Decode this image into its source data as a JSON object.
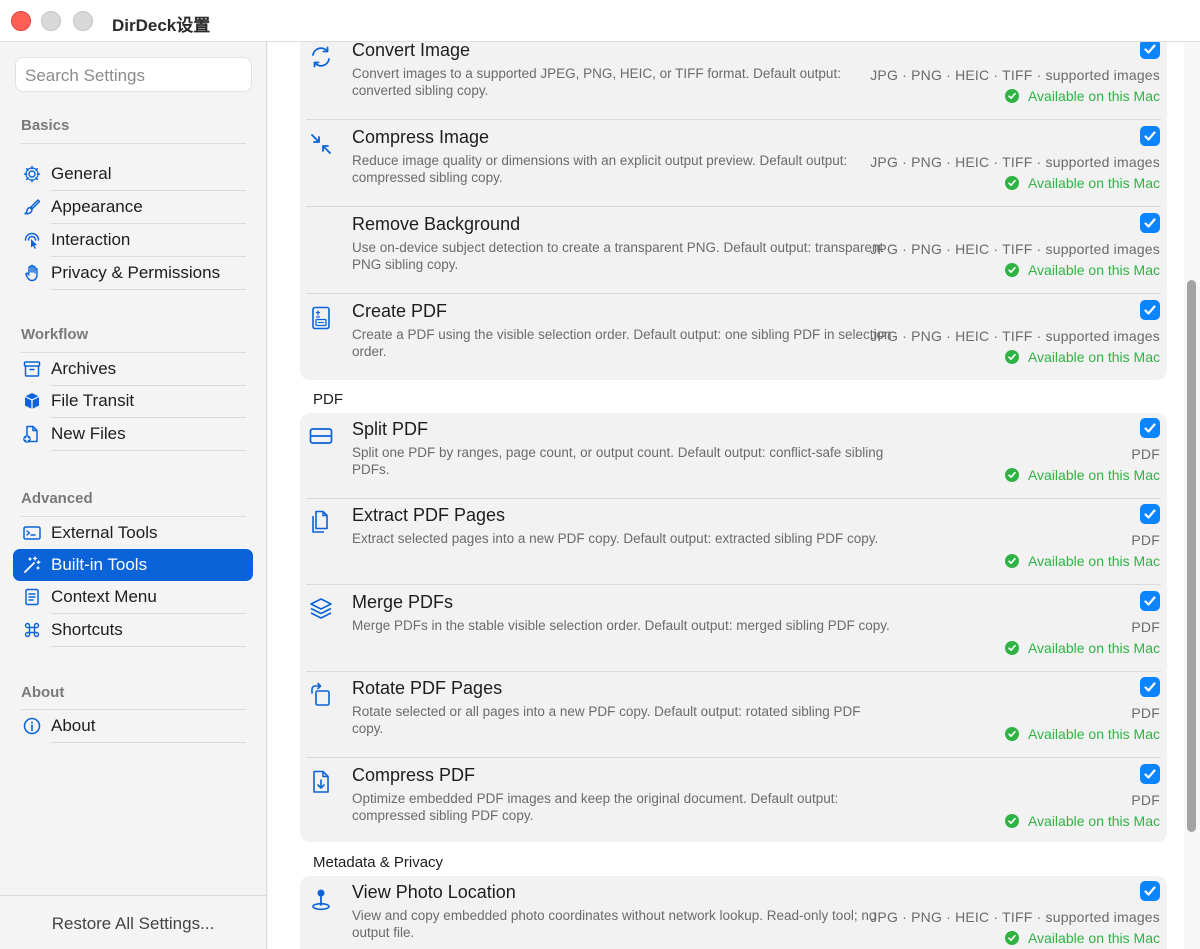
{
  "window": {
    "title": "DirDeck设置"
  },
  "sidebar": {
    "search_placeholder": "Search Settings",
    "sections": {
      "basics": "Basics",
      "workflow": "Workflow",
      "advanced": "Advanced",
      "about": "About"
    },
    "items": {
      "general": "General",
      "appearance": "Appearance",
      "interaction": "Interaction",
      "privacy": "Privacy & Permissions",
      "archives": "Archives",
      "file_transit": "File Transit",
      "new_files": "New Files",
      "external_tools": "External Tools",
      "builtin_tools": "Built-in Tools",
      "context_menu": "Context Menu",
      "shortcuts": "Shortcuts",
      "about": "About"
    },
    "selected": "Built-in Tools",
    "restore_label": "Restore All Settings..."
  },
  "content": {
    "image_formats": "JPG · PNG · HEIC · TIFF · supported images",
    "pdf_formats": "PDF",
    "available_label": "Available on this Mac",
    "groups": {
      "pdf": "PDF",
      "metadata": "Metadata & Privacy"
    },
    "tools": {
      "convert_image": {
        "title": "Convert Image",
        "desc": "Convert images to a supported JPEG, PNG, HEIC, or TIFF format. Default output: converted sibling copy.",
        "enabled": true
      },
      "compress_image": {
        "title": "Compress Image",
        "desc": "Reduce image quality or dimensions with an explicit output preview. Default output: compressed sibling copy.",
        "enabled": true
      },
      "remove_background": {
        "title": "Remove Background",
        "desc": "Use on-device subject detection to create a transparent PNG. Default output: transparent PNG sibling copy.",
        "enabled": true
      },
      "create_pdf": {
        "title": "Create PDF",
        "desc": "Create a PDF using the visible selection order. Default output: one sibling PDF in selection order.",
        "enabled": true
      },
      "split_pdf": {
        "title": "Split PDF",
        "desc": "Split one PDF by ranges, page count, or output count. Default output: conflict-safe sibling PDFs.",
        "enabled": true
      },
      "extract_pdf_pages": {
        "title": "Extract PDF Pages",
        "desc": "Extract selected pages into a new PDF copy. Default output: extracted sibling PDF copy.",
        "enabled": true
      },
      "merge_pdfs": {
        "title": "Merge PDFs",
        "desc": "Merge PDFs in the stable visible selection order. Default output: merged sibling PDF copy.",
        "enabled": true
      },
      "rotate_pdf_pages": {
        "title": "Rotate PDF Pages",
        "desc": "Rotate selected or all pages into a new PDF copy. Default output: rotated sibling PDF copy.",
        "enabled": true
      },
      "compress_pdf": {
        "title": "Compress PDF",
        "desc": "Optimize embedded PDF images and keep the original document. Default output: compressed sibling PDF copy.",
        "enabled": true
      },
      "view_photo_location": {
        "title": "View Photo Location",
        "desc": "View and copy embedded photo coordinates without network lookup. Read-only tool; no output file.",
        "enabled": true
      }
    }
  },
  "colors": {
    "accent": "#0a63d8",
    "checkbox": "#0a84ff",
    "available": "#2fb345",
    "close_button": "#ff5f57"
  },
  "scroll_position": 0.3
}
